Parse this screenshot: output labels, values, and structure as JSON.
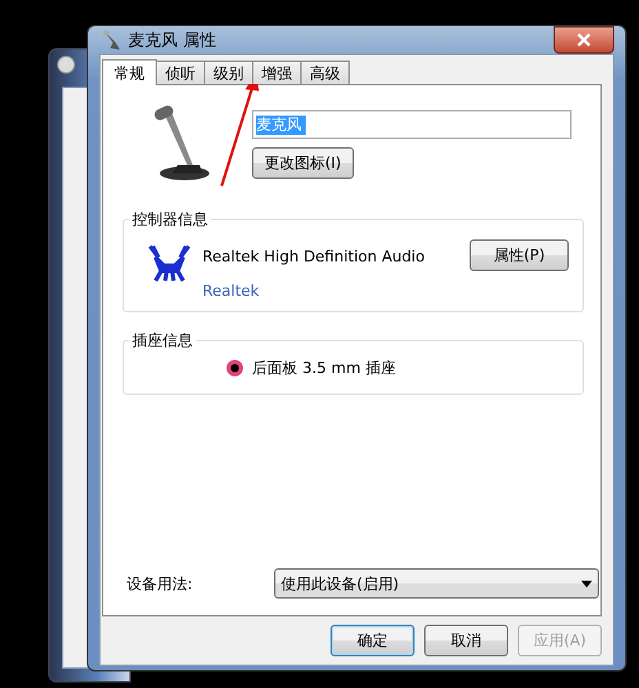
{
  "window": {
    "title": "麦克风 属性"
  },
  "tabs": [
    {
      "label": "常规",
      "selected": true
    },
    {
      "label": "侦听",
      "selected": false
    },
    {
      "label": "级别",
      "selected": false
    },
    {
      "label": "增强",
      "selected": false
    },
    {
      "label": "高级",
      "selected": false
    }
  ],
  "name_field": {
    "value": "麦克风",
    "text_selected": true
  },
  "change_icon_button": "更改图标(I)",
  "controller_info": {
    "title": "控制器信息",
    "name": "Realtek High Definition Audio",
    "link": "Realtek",
    "button": "属性(P)"
  },
  "jack_info": {
    "title": "插座信息",
    "jacks": [
      {
        "label": "后面板 3.5 mm 插座",
        "color": "#e0457b"
      }
    ]
  },
  "device_usage": {
    "label": "设备用法:",
    "value": "使用此设备(启用)"
  },
  "buttons": [
    {
      "label": "确定",
      "default": true,
      "disabled": false
    },
    {
      "label": "取消",
      "default": false,
      "disabled": false
    },
    {
      "label": "应用(A)",
      "default": false,
      "disabled": true
    }
  ]
}
